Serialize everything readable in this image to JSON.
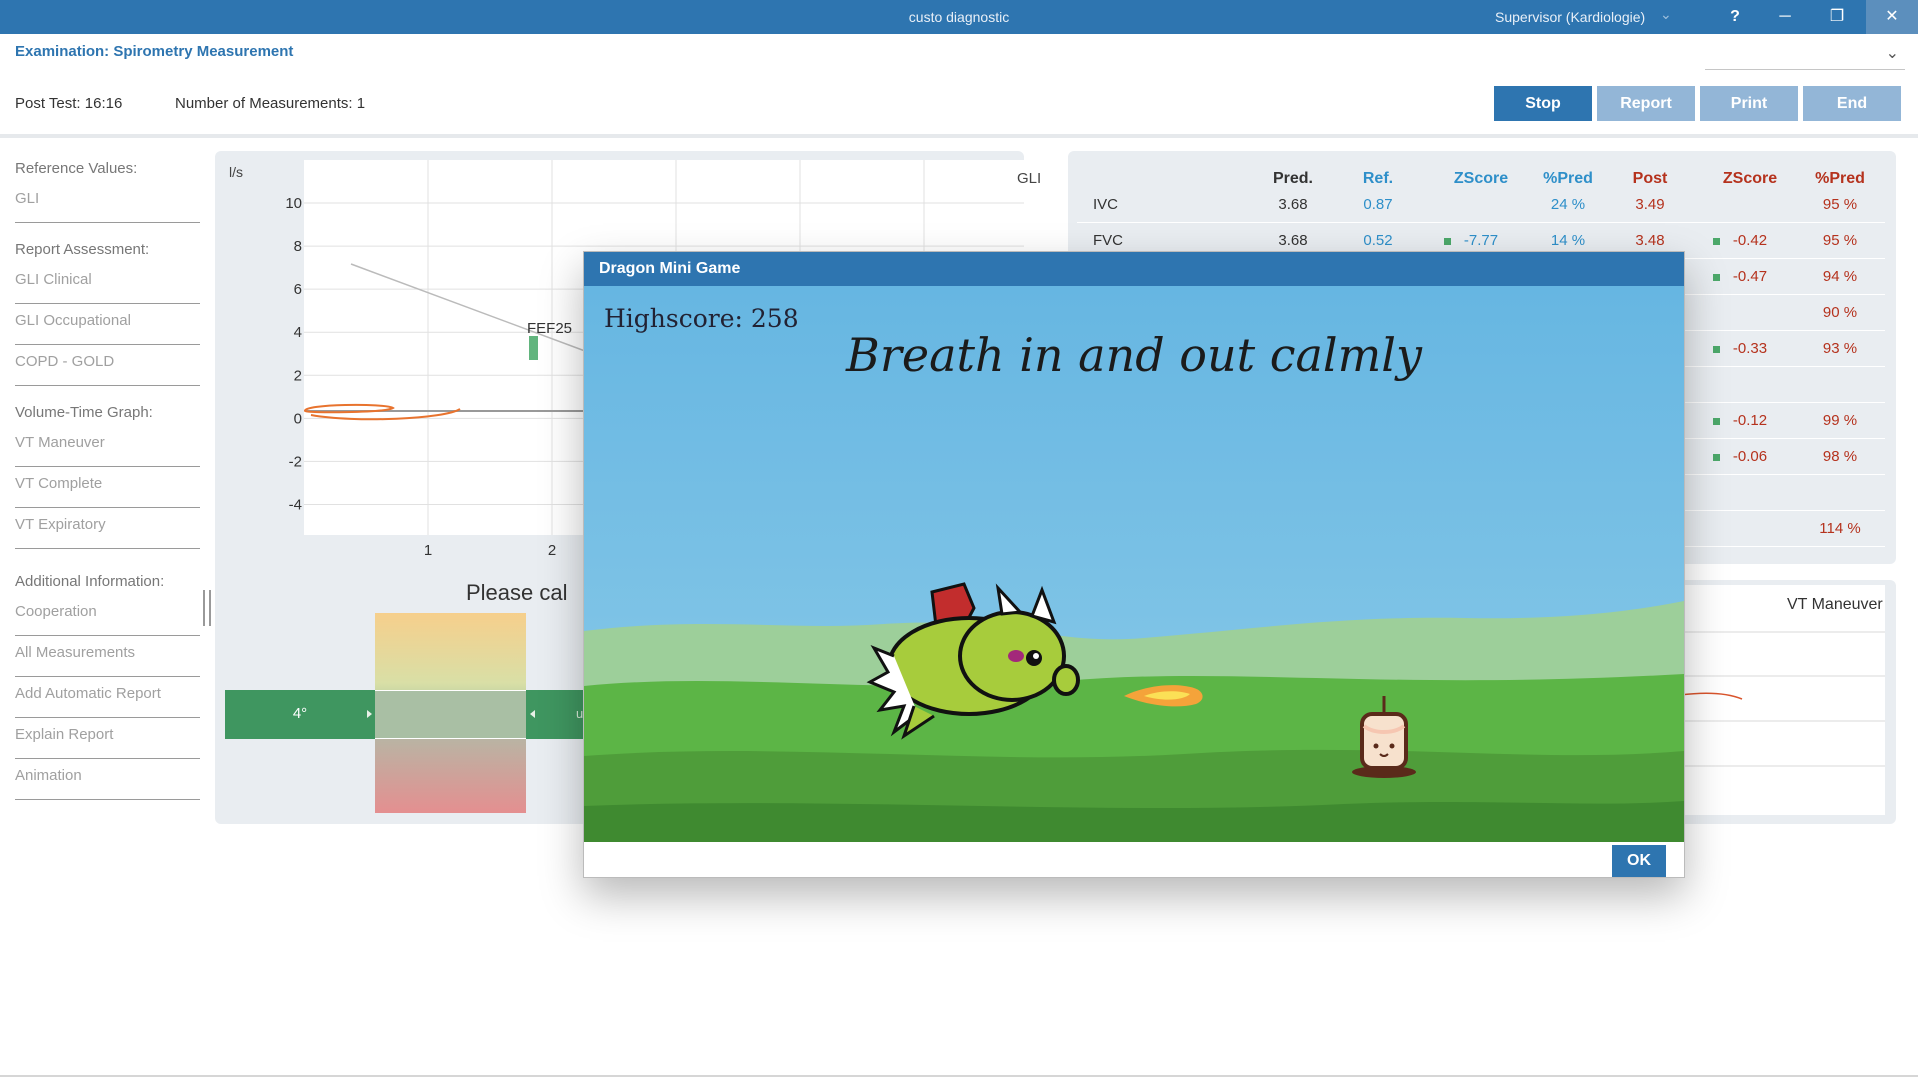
{
  "app": {
    "title": "custo diagnostic",
    "user": "Supervisor (Kardiologie)",
    "help_label": "?",
    "minimize_label": "─",
    "maximize_label": "❐",
    "close_label": "✕"
  },
  "header": {
    "exam_title": "Examination: Spirometry Measurement",
    "post_test": "Post Test: 16:16",
    "num_measurements": "Number of Measurements: 1",
    "buttons": {
      "stop": "Stop",
      "report": "Report",
      "print": "Print",
      "end": "End"
    }
  },
  "sidebar": {
    "reference_label": "Reference Values:",
    "reference_value": "GLI",
    "assessment_label": "Report Assessment:",
    "assessment_items": [
      "GLI Clinical",
      "GLI Occupational",
      "COPD - GOLD"
    ],
    "vt_label": "Volume-Time Graph:",
    "vt_items": [
      "VT Maneuver",
      "VT Complete",
      "VT Expiratory"
    ],
    "additional_label": "Additional Information:",
    "additional_items": [
      "Cooperation",
      "All Measurements",
      "Add Automatic Report",
      "Explain Report",
      "Animation"
    ]
  },
  "chart_data": {
    "type": "line",
    "title": "",
    "ylabel": "l/s",
    "xlabel": "",
    "ylim": [
      -5,
      10
    ],
    "yticks": [
      "10",
      "8",
      "6",
      "4",
      "2",
      "0",
      "-2",
      "-4"
    ],
    "xticks": [
      "1",
      "2"
    ],
    "reference_label": "GLI",
    "annotation": "FEF25",
    "prompt_visible": "Please cal",
    "gauge_value": "4°",
    "gauge_right_partial": "u"
  },
  "table": {
    "headers": {
      "pred": "Pred.",
      "ref": "Ref.",
      "zscore1": "ZScore",
      "pct1": "%Pred",
      "post": "Post",
      "zscore2": "ZScore",
      "pct2": "%Pred"
    },
    "rows": [
      {
        "name": "IVC",
        "pred": "3.68",
        "ref": "0.87",
        "z1": "",
        "pct1": "24 %",
        "post": "3.49",
        "z2": "",
        "pct2": "95 %"
      },
      {
        "name": "FVC",
        "pred": "3.68",
        "ref": "0.52",
        "z1": "-7.77",
        "pct1": "14 %",
        "post": "3.48",
        "z2": "-0.42",
        "pct2": "95 %"
      },
      {
        "name": "",
        "pred": "",
        "ref": "",
        "z1": "",
        "pct1": "",
        "post": "",
        "z2": "-0.47",
        "pct2": "94 %"
      },
      {
        "name": "",
        "pred": "",
        "ref": "",
        "z1": "",
        "pct1": "",
        "post": "",
        "z2": "",
        "pct2": "90 %"
      },
      {
        "name": "",
        "pred": "",
        "ref": "",
        "z1": "",
        "pct1": "",
        "post": "",
        "z2": "-0.33",
        "pct2": "93 %"
      },
      {
        "name": "",
        "pred": "",
        "ref": "",
        "z1": "",
        "pct1": "",
        "post": "",
        "z2": "",
        "pct2": ""
      },
      {
        "name": "",
        "pred": "",
        "ref": "",
        "z1": "",
        "pct1": "",
        "post": "",
        "z2": "-0.12",
        "pct2": "99 %"
      },
      {
        "name": "",
        "pred": "",
        "ref": "",
        "z1": "",
        "pct1": "",
        "post": "",
        "z2": "-0.06",
        "pct2": "98 %"
      },
      {
        "name": "",
        "pred": "",
        "ref": "",
        "z1": "",
        "pct1": "",
        "post": "",
        "z2": "",
        "pct2": ""
      },
      {
        "name": "",
        "pred": "",
        "ref": "",
        "z1": "",
        "pct1": "",
        "post": "",
        "z2": "",
        "pct2": "114 %"
      }
    ],
    "colors": {
      "header_dark": "#333333",
      "blue": "#2e8fc9",
      "red": "#b5321d",
      "green": "#4ca86a"
    }
  },
  "vt_panel": {
    "title": "VT Maneuver"
  },
  "modal": {
    "title": "Dragon Mini Game",
    "highscore": "Highscore: 258",
    "instruction": "Breath in and out calmly",
    "ok_label": "OK",
    "sprites": [
      "dragon-icon",
      "fireball-icon",
      "candle-icon"
    ]
  }
}
